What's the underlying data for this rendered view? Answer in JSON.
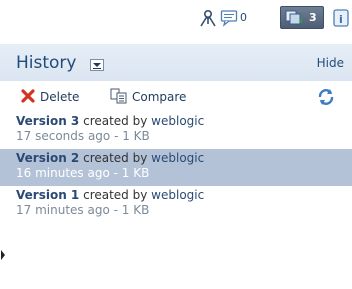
{
  "toolbar": {
    "comment_count": "0",
    "versions_count": "3",
    "icons": [
      "users-icon",
      "comment-icon",
      "versions-icon",
      "info-icon"
    ]
  },
  "history": {
    "title": "History",
    "hide_label": "Hide",
    "actions": {
      "delete_label": "Delete",
      "compare_label": "Compare"
    },
    "versions": [
      {
        "name": "Version 3",
        "created_by_text": "created by",
        "user": "weblogic",
        "details": "17 seconds ago - 1 KB",
        "selected": false
      },
      {
        "name": "Version 2",
        "created_by_text": "created by",
        "user": "weblogic",
        "details": "16 minutes ago - 1 KB",
        "selected": true
      },
      {
        "name": "Version 1",
        "created_by_text": "created by",
        "user": "weblogic",
        "details": "17 minutes ago - 1 KB",
        "selected": false
      }
    ]
  },
  "colors": {
    "header_bg": "#dbe5f1",
    "selected_row_bg": "#b4c2d8",
    "title_color": "#1f4d7a",
    "link_color": "#2a4a74"
  }
}
